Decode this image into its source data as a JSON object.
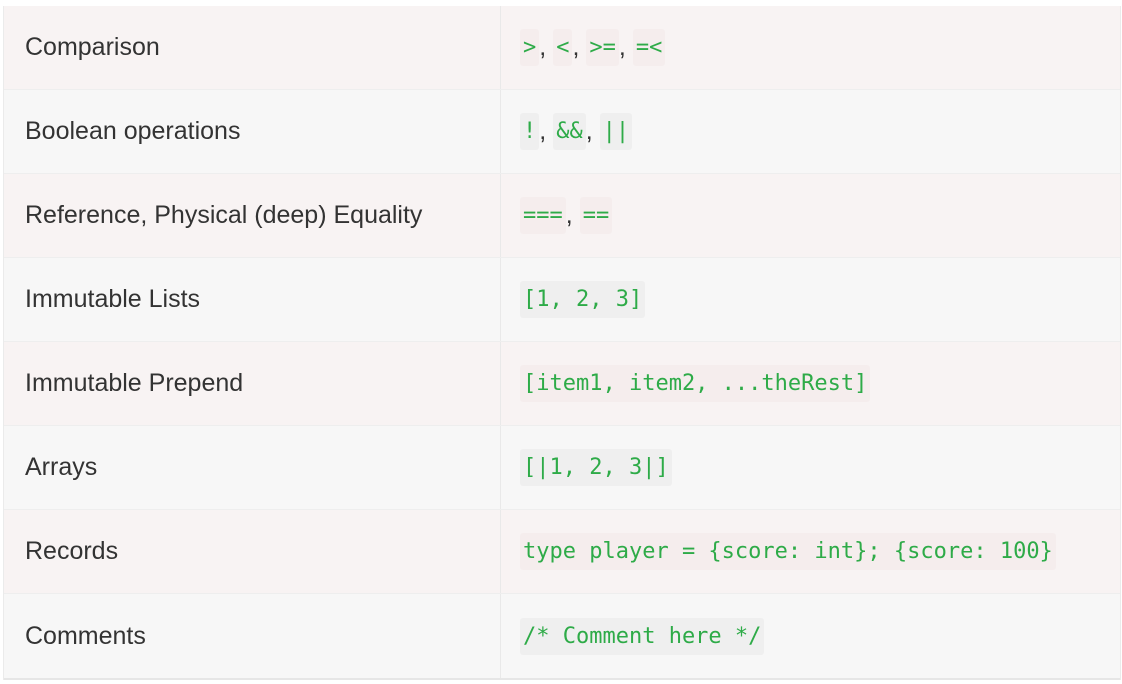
{
  "rows": [
    {
      "label": "Comparison",
      "codes": [
        ">",
        "<",
        ">=",
        "=<"
      ]
    },
    {
      "label": "Boolean operations",
      "codes": [
        "!",
        "&&",
        "||"
      ]
    },
    {
      "label": "Reference, Physical (deep) Equality",
      "codes": [
        "===",
        "=="
      ]
    },
    {
      "label": "Immutable Lists",
      "codes": [
        "[1, 2, 3]"
      ]
    },
    {
      "label": "Immutable Prepend",
      "codes": [
        "[item1, item2, ...theRest]"
      ]
    },
    {
      "label": "Arrays",
      "codes": [
        "[|1, 2, 3|]"
      ]
    },
    {
      "label": "Records",
      "codes": [
        "type player = {score: int}; {score: 100}"
      ]
    },
    {
      "label": "Comments",
      "codes": [
        "/* Comment here */"
      ]
    }
  ],
  "separator": ","
}
